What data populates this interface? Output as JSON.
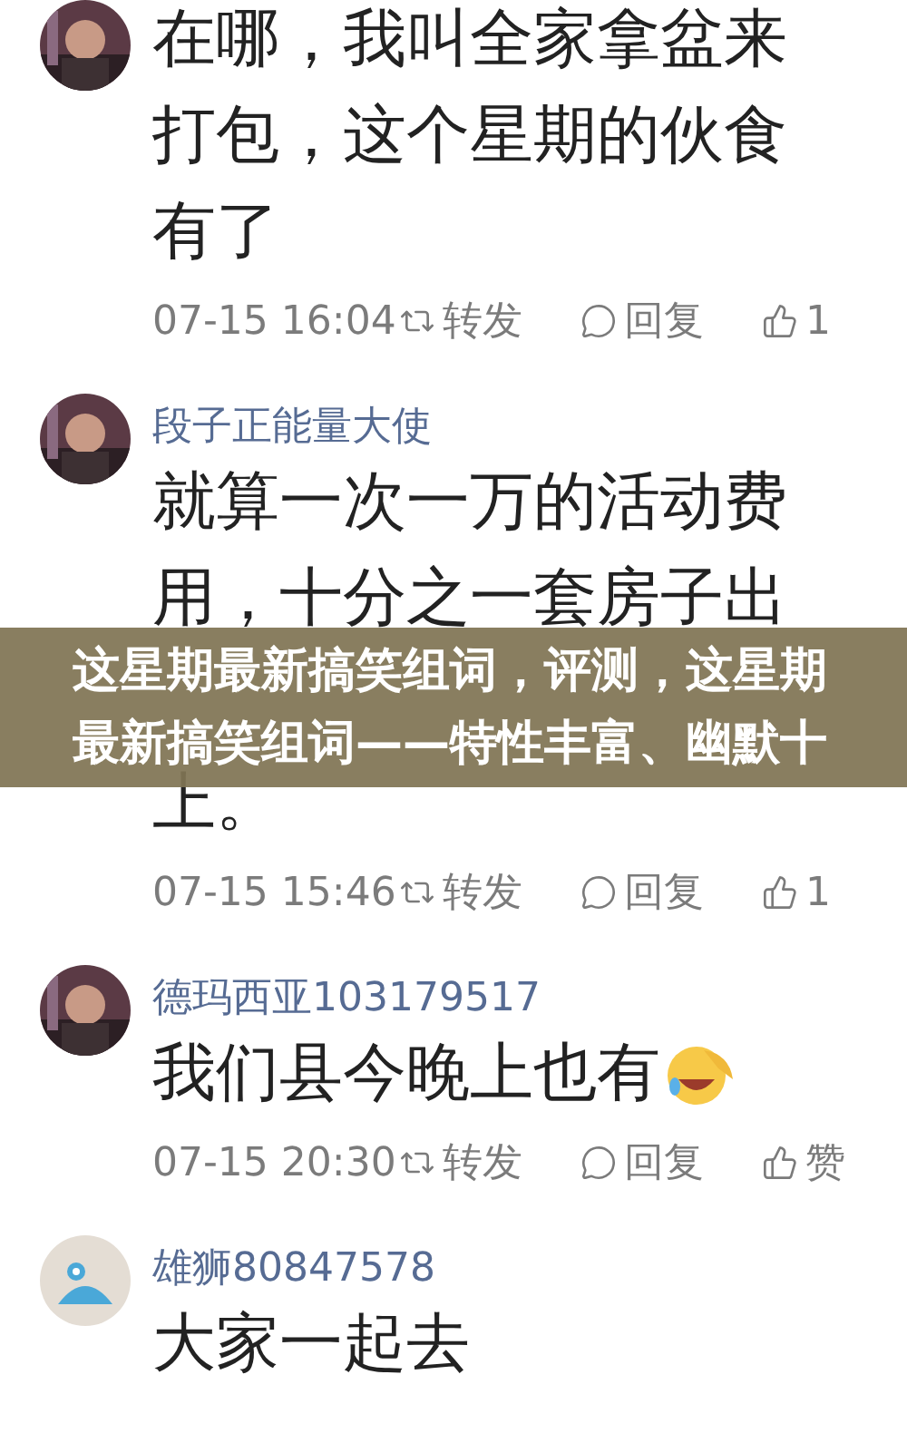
{
  "comments": [
    {
      "avatar": {
        "kind": "picture"
      },
      "lines": [
        {
          "kind": "text",
          "text": "在哪，我叫全家拿盆来"
        },
        {
          "kind": "text",
          "text": "打包，这个星期的伙食"
        },
        {
          "kind": "text",
          "text": "有了"
        }
      ],
      "time": "07-15 16:04",
      "share": "转发",
      "reply": "回复",
      "likes": "1"
    },
    {
      "avatar": {
        "kind": "picture"
      },
      "name": "段子正能量大使",
      "lines": [
        {
          "kind": "text",
          "text": "就算一次一万的活动费"
        },
        {
          "kind": "text",
          "text": "用，十分之一套房子出"
        },
        {
          "kind": "covered"
        },
        {
          "kind": "text",
          "text": "上。"
        }
      ],
      "time": "07-15 15:46",
      "share": "转发",
      "reply": "回复",
      "likes": "1"
    },
    {
      "avatar": {
        "kind": "picture"
      },
      "name": "德玛西亚103179517",
      "lines": [
        {
          "kind": "emoji",
          "text": "我们县今晚上也有"
        }
      ],
      "time": "07-15 20:30",
      "share": "转发",
      "reply": "回复",
      "likes": "赞"
    },
    {
      "avatar": {
        "kind": "cartoon"
      },
      "name": "雄狮80847578",
      "lines": [
        {
          "kind": "text",
          "text": "大家一起去"
        }
      ]
    }
  ],
  "banner": {
    "title": "这星期最新搞笑组词，评测，这星期最新搞笑组词——特性丰富、幽默十"
  }
}
